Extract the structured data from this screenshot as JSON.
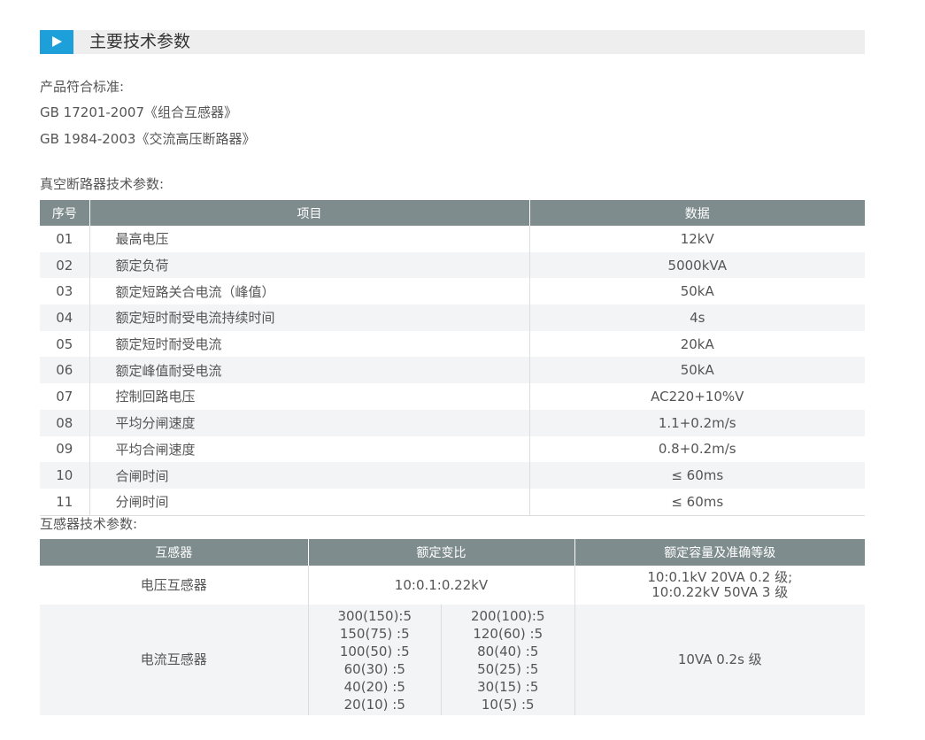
{
  "section": {
    "title": "主要技术参数"
  },
  "standards": {
    "label": "产品符合标准:",
    "items": [
      "GB 17201-2007《组合互感器》",
      "GB 1984-2003《交流高压断路器》"
    ]
  },
  "breaker": {
    "label": "真空断路器技术参数:",
    "headers": [
      "序号",
      "项目",
      "数据"
    ],
    "rows": [
      [
        "01",
        "最高电压",
        "12kV"
      ],
      [
        "02",
        "额定负荷",
        "5000kVA"
      ],
      [
        "03",
        "额定短路关合电流（峰值）",
        "50kA"
      ],
      [
        "04",
        "额定短时耐受电流持续时间",
        "4s"
      ],
      [
        "05",
        "额定短时耐受电流",
        "20kA"
      ],
      [
        "06",
        "额定峰值耐受电流",
        "50kA"
      ],
      [
        "07",
        "控制回路电压",
        "AC220+10%V"
      ],
      [
        "08",
        "平均分闸速度",
        "1.1+0.2m/s"
      ],
      [
        "09",
        "平均合闸速度",
        "0.8+0.2m/s"
      ],
      [
        "10",
        "合闸时间",
        "≤ 60ms"
      ],
      [
        "11",
        "分闸时间",
        "≤ 60ms"
      ]
    ]
  },
  "transformer": {
    "label": "互感器技术参数:",
    "headers": [
      "互感器",
      "额定变比",
      "额定容量及准确等级"
    ],
    "pt": {
      "name": "电压互感器",
      "ratio": "10:0.1:0.22kV",
      "capacity": [
        "10:0.1kV 20VA 0.2 级;",
        "10:0.22kV 50VA 3 级"
      ]
    },
    "ct": {
      "name": "电流互感器",
      "ratios_left": [
        "300(150):5",
        "150(75) :5",
        "100(50) :5",
        "60(30) :5",
        "40(20) :5",
        "20(10) :5"
      ],
      "ratios_right": [
        "200(100):5",
        "120(60) :5",
        "80(40) :5",
        "50(25) :5",
        "30(15) :5",
        "10(5) :5"
      ],
      "capacity": "10VA 0.2s 级"
    }
  },
  "colors": {
    "accent": "#1d9fd9",
    "table_header": "#7f8c8d",
    "row_alt": "#f3f4f6"
  }
}
